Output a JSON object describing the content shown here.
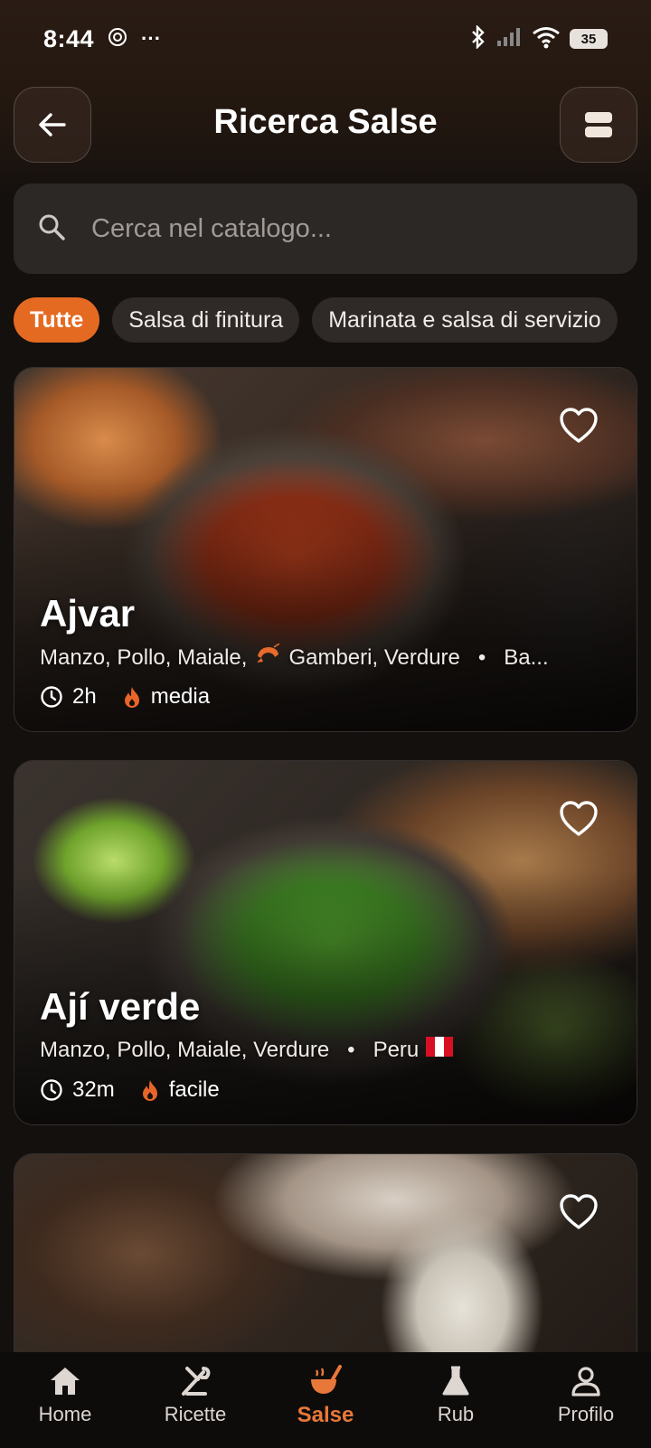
{
  "status_bar": {
    "time": "8:44",
    "extra": "···",
    "battery": "35"
  },
  "header": {
    "title": "Ricerca Salse"
  },
  "search": {
    "placeholder": "Cerca nel catalogo..."
  },
  "chips": [
    {
      "label": "Tutte",
      "active": true
    },
    {
      "label": "Salsa di finitura",
      "active": false
    },
    {
      "label": "Marinata e salsa di servizio",
      "active": false
    }
  ],
  "cards": [
    {
      "title": "Ajvar",
      "meta_proteins": "Manzo, Pollo, Maiale,",
      "meta_shrimp": "Gamberi, Verdure",
      "meta_origin": "Ba...",
      "time": "2h",
      "difficulty": "media"
    },
    {
      "title": "Ají verde",
      "meta_proteins": "Manzo, Pollo, Maiale, Verdure",
      "meta_origin": "Peru",
      "time": "32m",
      "difficulty": "facile"
    },
    {
      "title": ""
    }
  ],
  "nav": {
    "home": "Home",
    "ricette": "Ricette",
    "salse": "Salse",
    "rub": "Rub",
    "profilo": "Profilo"
  },
  "colors": {
    "accent": "#e46a22",
    "background": "#14100e",
    "search_bg": "#2c2826"
  }
}
